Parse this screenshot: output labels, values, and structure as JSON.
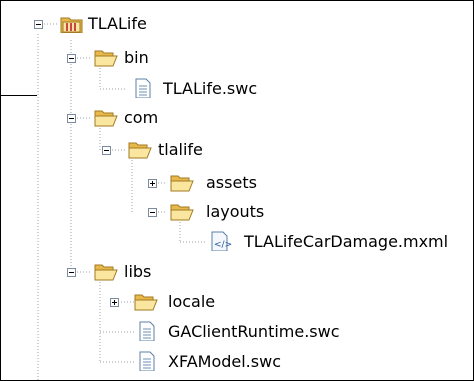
{
  "tree": {
    "project": "TLALife",
    "bin": "bin",
    "bin_file": "TLALife.swc",
    "com": "com",
    "tlalife": "tlalife",
    "assets": "assets",
    "layouts": "layouts",
    "layout_file": "TLALifeCarDamage.mxml",
    "libs": "libs",
    "locale": "locale",
    "lib_file_1": "GAClientRuntime.swc",
    "lib_file_2": "XFAModel.swc"
  },
  "icons": {
    "project": "project-folder-icon",
    "folder": "folder-open-icon",
    "file": "document-icon",
    "mxml": "mxml-file-icon"
  },
  "colors": {
    "folder": "#e8b84a",
    "folder_light": "#fbe6a0",
    "line": "#9aa3ad",
    "toggle_border": "#7b8a9c"
  }
}
